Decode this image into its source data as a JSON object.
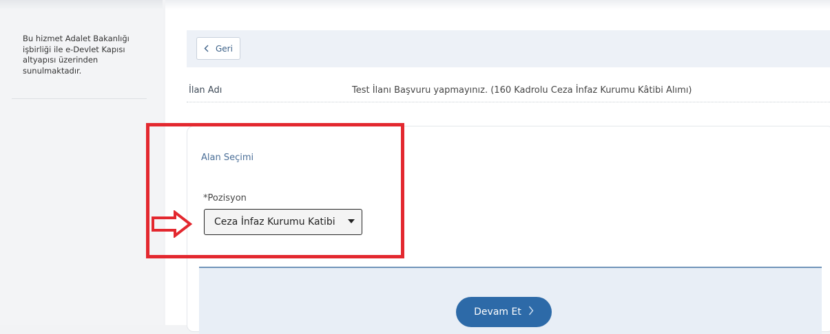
{
  "sidebar": {
    "note": "Bu hizmet Adalet Bakanlığı işbirliği ile e-Devlet Kapısı altyapısı üzerinden sunulmaktadır."
  },
  "toolbar": {
    "back_label": "Geri",
    "back_icon": "chevron-left-icon"
  },
  "listing": {
    "label": "İlan Adı",
    "value": "Test İlanı Başvuru yapmayınız. (160 Kadrolu Ceza İnfaz Kurumu Kâtibi Alımı)"
  },
  "form": {
    "section_title": "Alan Seçimi",
    "position_label": "*Pozisyon",
    "position_selected": "Ceza İnfaz Kurumu Katibi"
  },
  "actions": {
    "continue_label": "Devam Et",
    "continue_icon": "chevron-right-icon"
  },
  "annotation": {
    "highlight_color": "#e3282f"
  }
}
